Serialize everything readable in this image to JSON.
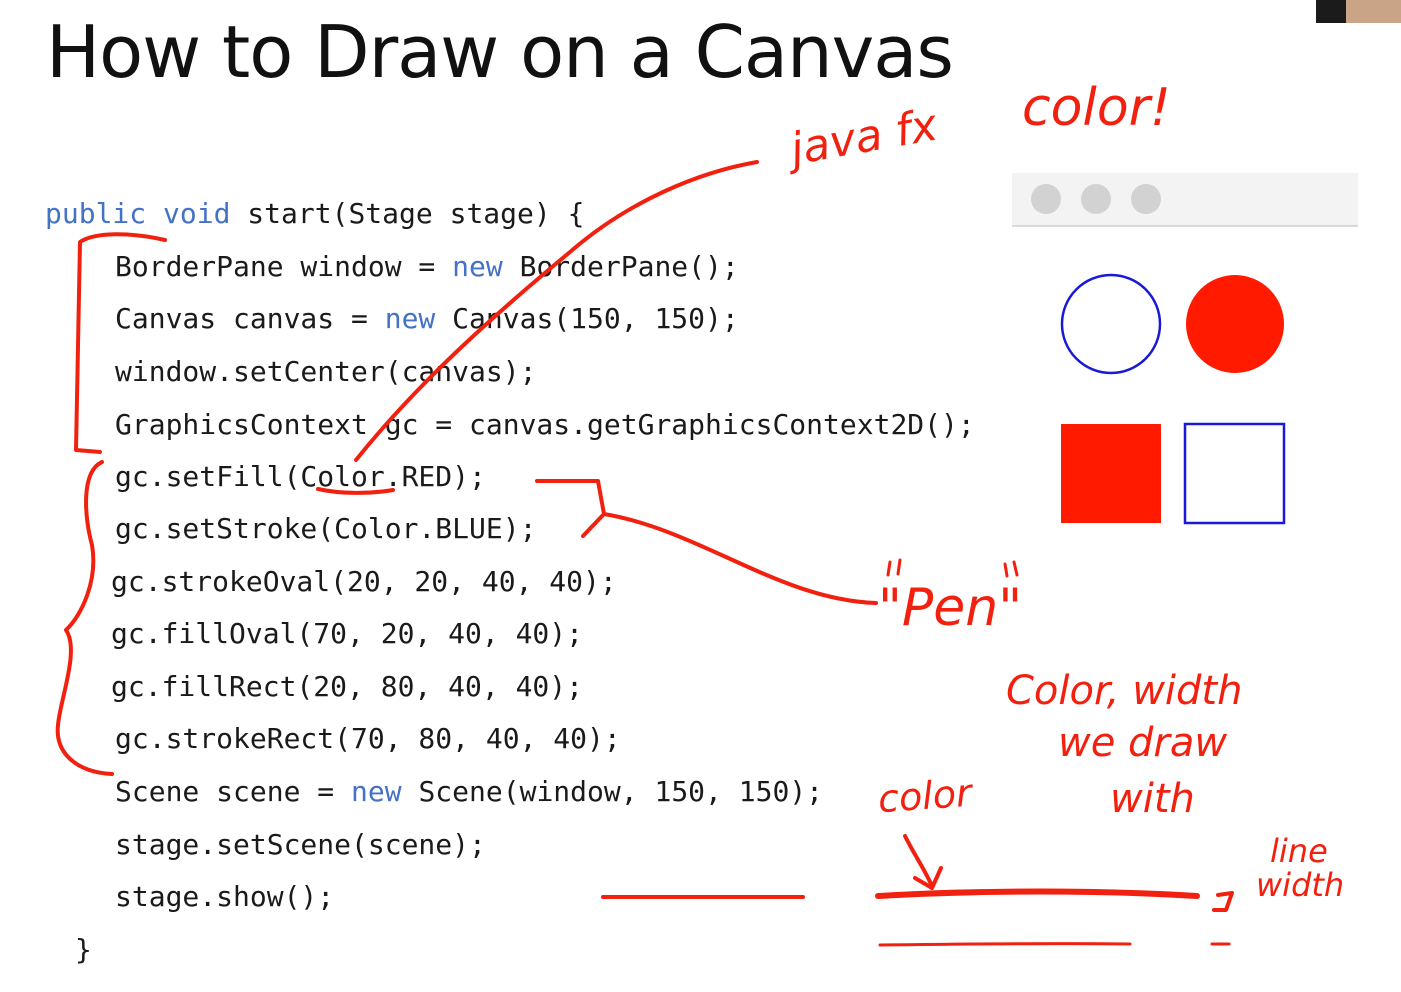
{
  "slide": {
    "title": "How to Draw on a Canvas"
  },
  "code": {
    "lines": [
      {
        "kw": "public void",
        "rest": " start(Stage stage) {"
      },
      {
        "pre": "BorderPane window = ",
        "kw": "new",
        "rest": " BorderPane();"
      },
      {
        "pre": "Canvas canvas = ",
        "kw": "new",
        "rest": " Canvas(150, 150);"
      },
      {
        "rest": "window.setCenter(canvas);"
      },
      {
        "rest": "GraphicsContext gc = canvas.getGraphicsContext2D();"
      },
      {
        "rest": "gc.setFill(Color.RED);"
      },
      {
        "rest": "gc.setStroke(Color.BLUE);"
      },
      {
        "rest": "gc.strokeOval(20, 20, 40, 40);"
      },
      {
        "rest": "gc.fillOval(70, 20, 40, 40);"
      },
      {
        "rest": "gc.fillRect(20, 80, 40, 40);"
      },
      {
        "rest": "gc.strokeRect(70, 80, 40, 40);"
      },
      {
        "pre": "Scene scene = ",
        "kw": "new",
        "rest": " Scene(window, 150, 150);"
      },
      {
        "rest": "stage.setScene(scene);"
      },
      {
        "rest": "stage.show();"
      },
      {
        "rest": "}"
      }
    ]
  },
  "preview": {
    "fill_color": "#ff1a00",
    "stroke_color": "#1a1ad6",
    "shapes": [
      "stroke-oval",
      "fill-oval",
      "fill-rect",
      "stroke-rect"
    ]
  },
  "annotations": {
    "javafx": "java fx",
    "color_exclaim": "color!",
    "pen": "\"Pen\"",
    "pen_desc_1": "Color, width",
    "pen_desc_2": "we draw",
    "pen_desc_3": "with",
    "color_label": "color",
    "line_label": "line",
    "width_label": "width",
    "ink_color": "#f2200f"
  }
}
